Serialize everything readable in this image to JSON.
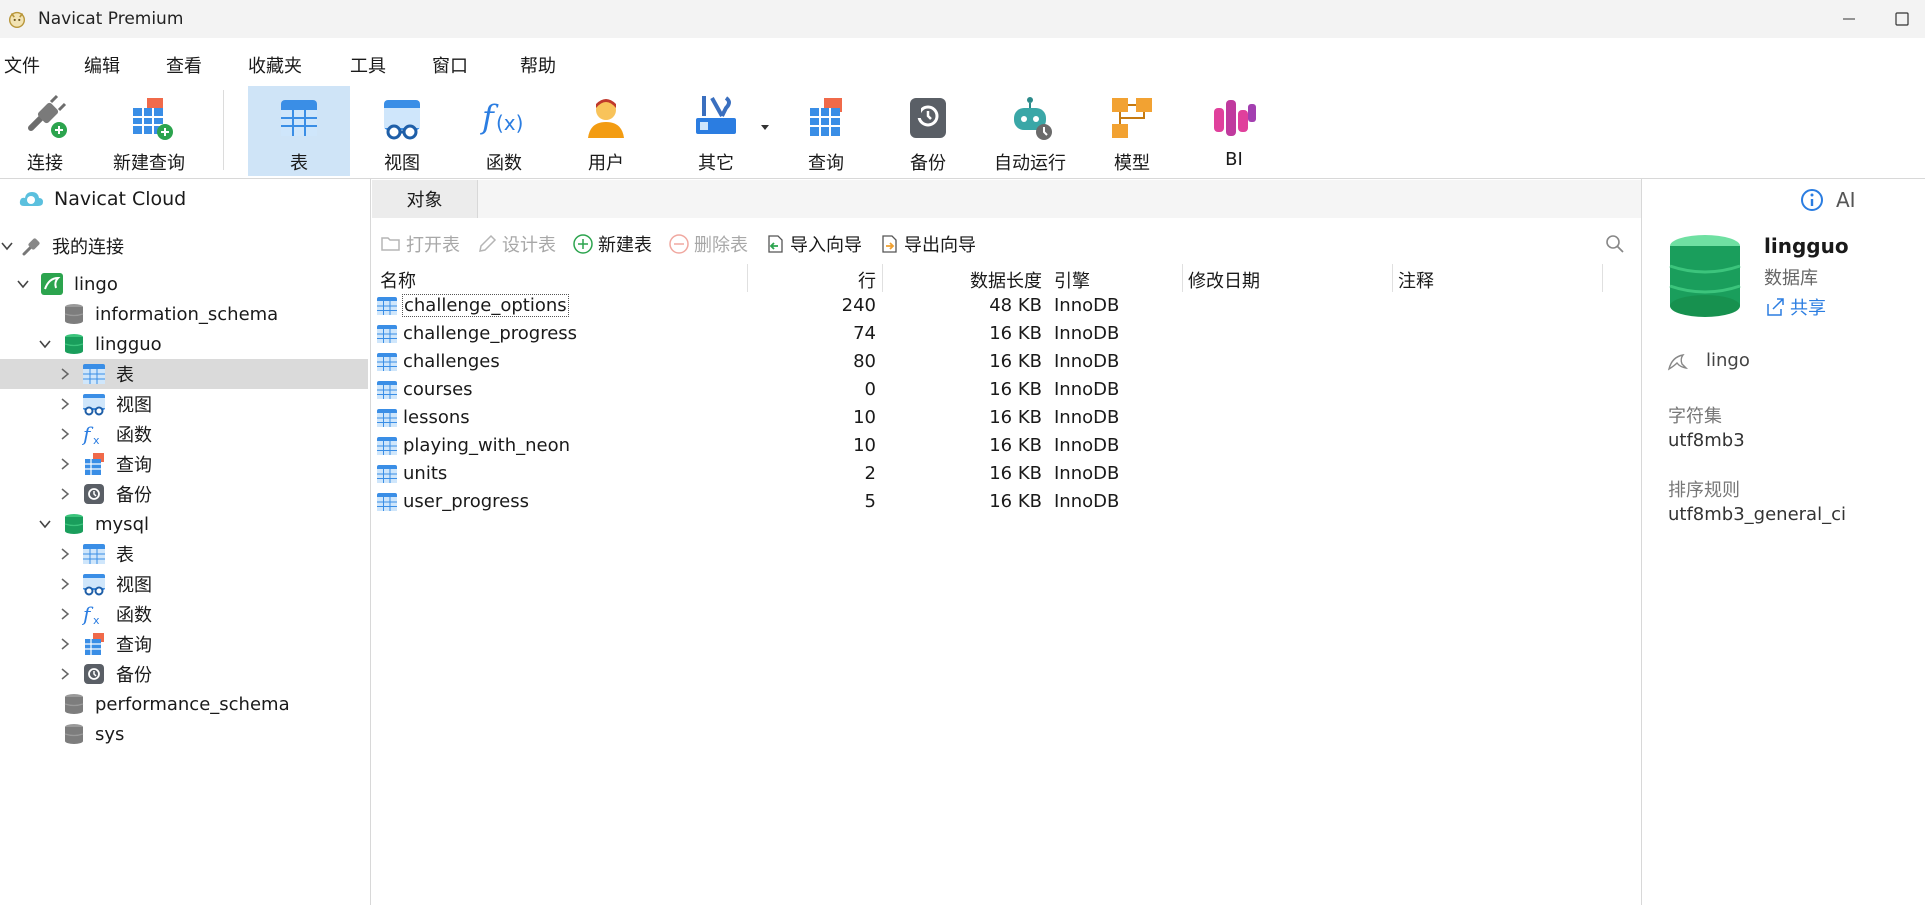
{
  "app": {
    "title": "Navicat Premium"
  },
  "menu": [
    "文件",
    "编辑",
    "查看",
    "收藏夹",
    "工具",
    "窗口",
    "帮助"
  ],
  "toolbar": {
    "connect": "连接",
    "new_query": "新建查询",
    "table": "表",
    "view": "视图",
    "function": "函数",
    "user": "用户",
    "other": "其它",
    "query": "查询",
    "backup": "备份",
    "automation": "自动运行",
    "model": "模型",
    "bi": "BI"
  },
  "sidebar": {
    "cloud": "Navicat Cloud",
    "my_connections": "我的连接",
    "connection": "lingo",
    "databases": {
      "info_schema": "information_schema",
      "lingguo": "lingguo",
      "mysql": "mysql",
      "perf_schema": "performance_schema",
      "sys": "sys"
    },
    "lingguo_children": [
      "表",
      "视图",
      "函数",
      "查询",
      "备份"
    ],
    "mysql_children": [
      "表",
      "视图",
      "函数",
      "查询",
      "备份"
    ]
  },
  "tabs": {
    "objects": "对象"
  },
  "object_toolbar": {
    "open_table": "打开表",
    "design_table": "设计表",
    "new_table": "新建表",
    "delete_table": "删除表",
    "import_wizard": "导入向导",
    "export_wizard": "导出向导"
  },
  "grid": {
    "columns": [
      "名称",
      "行",
      "数据长度",
      "引擎",
      "修改日期",
      "注释"
    ],
    "rows": [
      {
        "name": "challenge_options",
        "rows": "240",
        "size": "48 KB",
        "engine": "InnoDB"
      },
      {
        "name": "challenge_progress",
        "rows": "74",
        "size": "16 KB",
        "engine": "InnoDB"
      },
      {
        "name": "challenges",
        "rows": "80",
        "size": "16 KB",
        "engine": "InnoDB"
      },
      {
        "name": "courses",
        "rows": "0",
        "size": "16 KB",
        "engine": "InnoDB"
      },
      {
        "name": "lessons",
        "rows": "10",
        "size": "16 KB",
        "engine": "InnoDB"
      },
      {
        "name": "playing_with_neon",
        "rows": "10",
        "size": "16 KB",
        "engine": "InnoDB"
      },
      {
        "name": "units",
        "rows": "2",
        "size": "16 KB",
        "engine": "InnoDB"
      },
      {
        "name": "user_progress",
        "rows": "5",
        "size": "16 KB",
        "engine": "InnoDB"
      }
    ]
  },
  "details": {
    "ai_label": "AI",
    "db_name": "lingguo",
    "db_type": "数据库",
    "share": "共享",
    "connection": "lingo",
    "charset_label": "字符集",
    "charset_value": "utf8mb3",
    "collation_label": "排序规则",
    "collation_value": "utf8mb3_general_ci"
  },
  "colors": {
    "selected_bg": "#dadada",
    "active_tool_bg": "#cfe4f7",
    "db_green": "#1a9e5c",
    "accent_blue": "#2b7de1"
  }
}
